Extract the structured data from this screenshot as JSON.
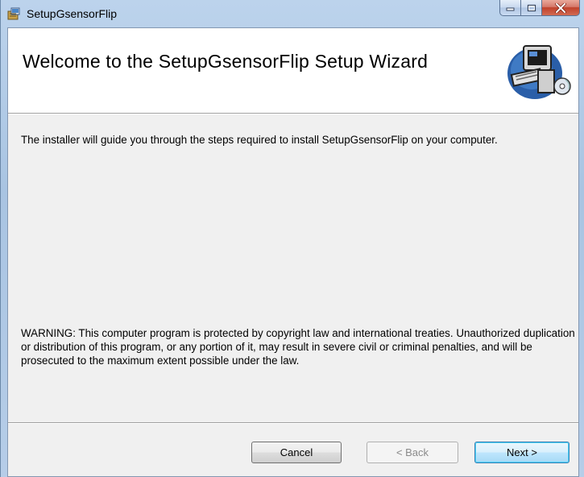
{
  "window": {
    "title": "SetupGsensorFlip",
    "caption_buttons": [
      "minimize",
      "maximize",
      "close"
    ]
  },
  "banner": {
    "title": "Welcome to the SetupGsensorFlip Setup Wizard",
    "icon": "computer-setup-icon"
  },
  "content": {
    "intro": "The installer will guide you through the steps required to install SetupGsensorFlip on your computer.",
    "warning": "WARNING: This computer program is protected by copyright law and international treaties. Unauthorized duplication or distribution of this program, or any portion of it, may result in severe civil or criminal penalties, and will be prosecuted to the maximum extent possible under the law."
  },
  "buttons": {
    "cancel": "Cancel",
    "back": "< Back",
    "next": "Next >"
  },
  "colors": {
    "frame": "#aac6e3",
    "client_bg": "#f0f0f0",
    "close_red": "#c0412b",
    "next_focus": "#3c7fb1"
  }
}
